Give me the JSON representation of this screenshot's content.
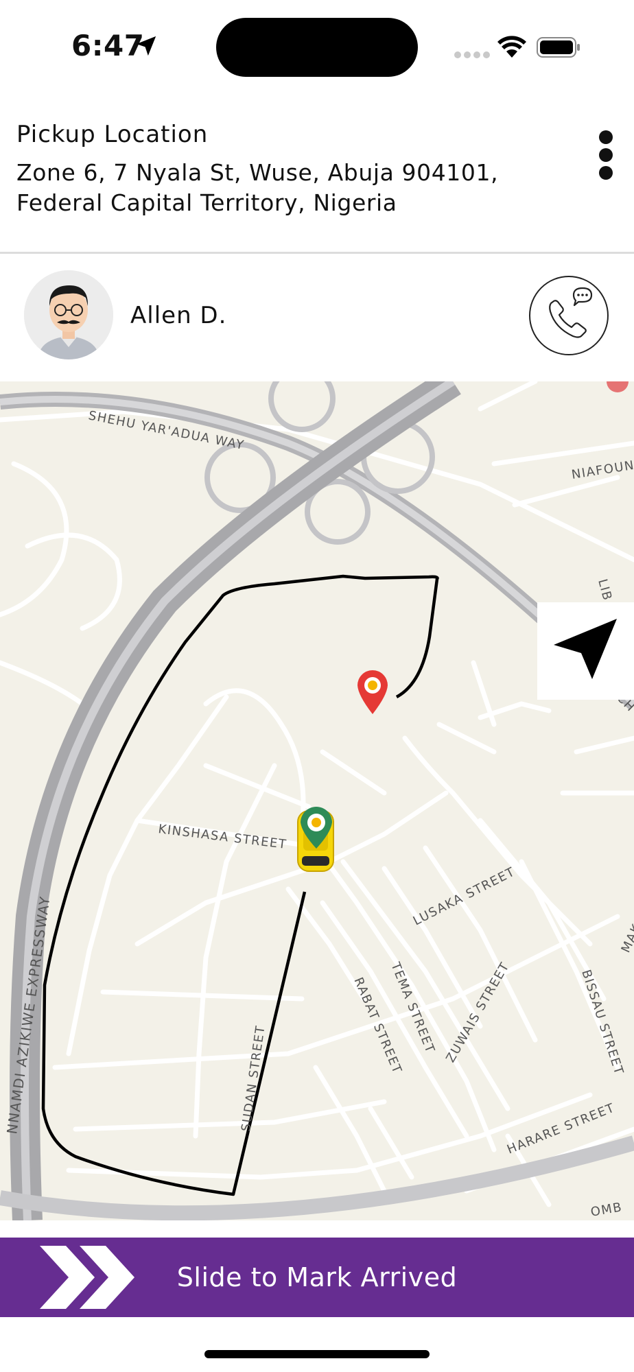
{
  "status_bar": {
    "time": "6:47",
    "icons": [
      "location-arrow-icon",
      "signal-icon",
      "wifi-icon",
      "battery-icon"
    ]
  },
  "pickup": {
    "title": "Pickup Location",
    "address": "Zone 6, 7 Nyala St, Wuse, Abuja 904101, Federal Capital Territory, Nigeria"
  },
  "driver": {
    "name": "Allen D.",
    "contact_icon": "phone-chat-icon"
  },
  "map": {
    "street_labels": {
      "shehu": "SHEHU YAR'ADUA WAY",
      "niafoun": "NIAFOUN",
      "lib": "LIB",
      "ch": "CH",
      "kinshasa": "KINSHASA STREET",
      "lusaka": "LUSAKA STREET",
      "tema": "TEMA STREET",
      "rabat": "RABAT STREET",
      "zuwais": "ZUWAIS STREET",
      "bissau": "BISSAU STREET",
      "mak": "MAK",
      "harare": "HARARE STREET",
      "sudan": "SUDAN STREET",
      "nnamdi": "NNAMDI AZIKIWE EXPRESSWAY",
      "omb": "OMB"
    },
    "route_color": "#000000",
    "pickup_pin_color": "#e53935",
    "vehicle_pin_color": "#2e8b57"
  },
  "slide": {
    "label": "Slide to Mark Arrived",
    "color": "#662d91"
  }
}
